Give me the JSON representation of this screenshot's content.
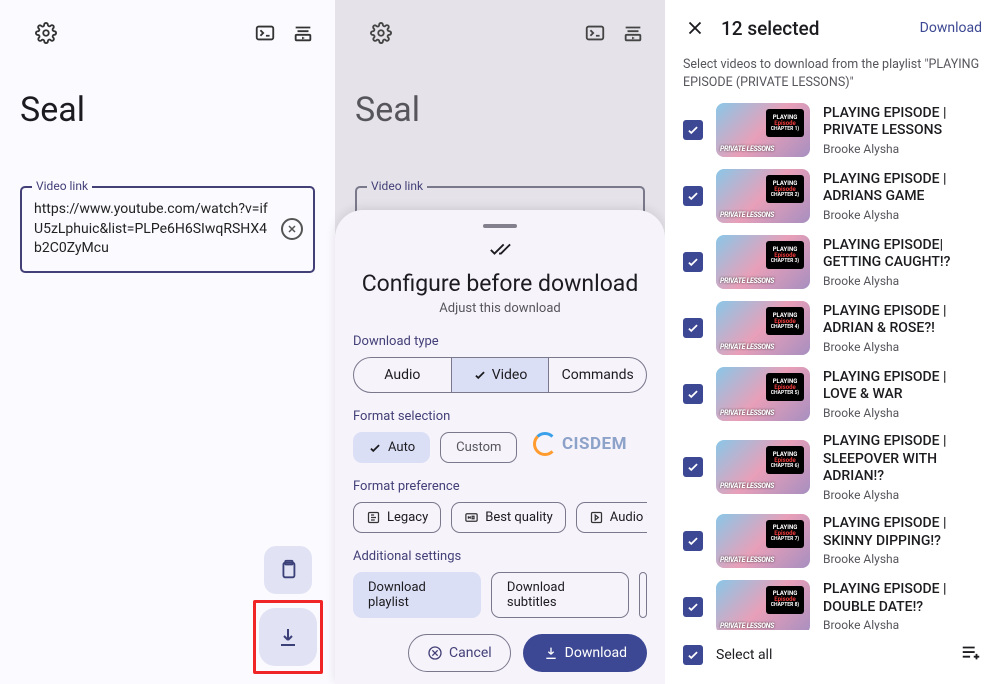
{
  "panel1": {
    "appTitle": "Seal",
    "linkLabel": "Video link",
    "linkValue": "https://www.youtube.com/watch?v=ifU5zLphuic&list=PLPe6H6SIwqRSHX4b2C0ZyMcu"
  },
  "panel2": {
    "appTitle": "Seal",
    "linkLabel": "Video link",
    "sheet": {
      "title": "Configure before download",
      "subtitle": "Adjust this download",
      "typeLabel": "Download type",
      "typeOptions": {
        "audio": "Audio",
        "video": "Video",
        "commands": "Commands"
      },
      "formatSelLabel": "Format selection",
      "formatOptions": {
        "auto": "Auto",
        "custom": "Custom"
      },
      "formatPrefLabel": "Format preference",
      "prefs": {
        "legacy": "Legacy",
        "best": "Best quality",
        "audiofmt": "Audio form"
      },
      "addlLabel": "Additional settings",
      "addl": {
        "playlist": "Download playlist",
        "subs": "Download subtitles"
      },
      "cancel": "Cancel",
      "download": "Download",
      "watermark": "CISDEM"
    }
  },
  "panel3": {
    "selectedCount": "12 selected",
    "downloadLink": "Download",
    "note": "Select videos to download from the playlist \"PLAYING EPISODE (PRIVATE LESSONS)\"",
    "selectAll": "Select all",
    "items": [
      {
        "title": "PLAYING EPISODE | PRIVATE LESSONS",
        "author": "Brooke Alysha",
        "chapter": "CHAPTER 1)"
      },
      {
        "title": "PLAYING EPISODE | ADRIANS GAME",
        "author": "Brooke Alysha",
        "chapter": "CHAPTER 2)"
      },
      {
        "title": "PLAYING EPISODE| GETTING CAUGHT!?",
        "author": "Brooke Alysha",
        "chapter": "CHAPTER 3)"
      },
      {
        "title": "PLAYING EPISODE | ADRIAN & ROSE?!",
        "author": "Brooke Alysha",
        "chapter": "CHAPTER 4)"
      },
      {
        "title": "PLAYING EPISODE | LOVE & WAR",
        "author": "Brooke Alysha",
        "chapter": "CHAPTER 5)"
      },
      {
        "title": "PLAYING EPISODE | SLEEPOVER WITH ADRIAN!?",
        "author": "Brooke Alysha",
        "chapter": "CHAPTER 6)"
      },
      {
        "title": "PLAYING EPISODE | SKINNY DIPPING!?",
        "author": "Brooke Alysha",
        "chapter": "CHAPTER 7)"
      },
      {
        "title": "PLAYING EPISODE | DOUBLE DATE!?",
        "author": "Brooke Alysha",
        "chapter": "CHAPTER 8)"
      }
    ]
  }
}
